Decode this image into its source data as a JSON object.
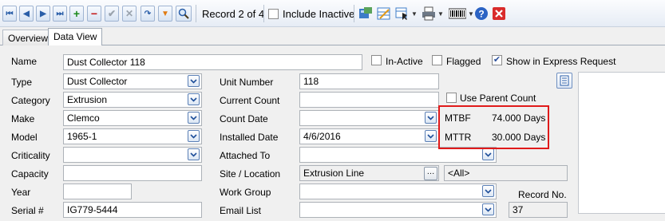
{
  "toolbar": {
    "record_label": "Record 2 of 4",
    "include_inactive_label": "Include Inactive",
    "include_inactive_checked": false,
    "icons": [
      "first-record-icon",
      "prev-record-icon",
      "next-record-icon",
      "last-record-icon",
      "add-icon",
      "delete-icon",
      "save-icon",
      "cancel-icon",
      "refresh-icon",
      "filter-icon",
      "search-icon",
      "import-icon",
      "edit-grid-icon",
      "select-icon",
      "print-icon",
      "barcode-icon",
      "help-icon",
      "close-icon"
    ]
  },
  "tabs": [
    {
      "label": "Overview",
      "active": false
    },
    {
      "label": "Data View",
      "active": true
    }
  ],
  "form": {
    "name_label": "Name",
    "name_value": "Dust Collector 118",
    "inactive_label": "In-Active",
    "inactive_checked": false,
    "flagged_label": "Flagged",
    "flagged_checked": false,
    "express_label": "Show in Express Request",
    "express_checked": true,
    "type_label": "Type",
    "type_value": "Dust Collector",
    "category_label": "Category",
    "category_value": "Extrusion",
    "make_label": "Make",
    "make_value": "Clemco",
    "model_label": "Model",
    "model_value": "1965-1",
    "criticality_label": "Criticality",
    "criticality_value": "",
    "capacity_label": "Capacity",
    "capacity_value": "",
    "year_label": "Year",
    "year_value": "",
    "serial_label": "Serial #",
    "serial_value": "IG779-5444",
    "unit_number_label": "Unit Number",
    "unit_number_value": "118",
    "current_count_label": "Current Count",
    "current_count_value": "",
    "use_parent_count_label": "Use Parent Count",
    "use_parent_count_checked": false,
    "count_date_label": "Count Date",
    "count_date_value": "",
    "installed_date_label": "Installed Date",
    "installed_date_value": "4/6/2016",
    "attached_to_label": "Attached To",
    "attached_to_value": "",
    "site_location_label": "Site / Location",
    "site_location_value": "Extrusion Line",
    "site_all_value": "<All>",
    "work_group_label": "Work Group",
    "work_group_value": "",
    "email_list_label": "Email List",
    "email_list_value": "",
    "record_no_label": "Record No.",
    "record_no_value": "37",
    "mtbf_label": "MTBF",
    "mtbf_value": "74.000 Days",
    "mttr_label": "MTTR",
    "mttr_value": "30.000 Days"
  },
  "colors": {
    "highlight_box": "#e01a1a",
    "panel_bg": "#f0f0f0",
    "accent": "#2a5ea8"
  }
}
